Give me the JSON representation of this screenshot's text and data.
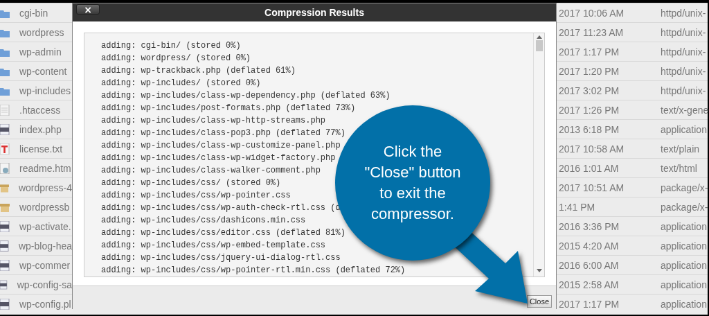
{
  "files": [
    {
      "kind": "folder",
      "name": "cgi-bin",
      "modified": "2017 10:06 AM",
      "type": "httpd/unix-"
    },
    {
      "kind": "folder",
      "name": "wordpress",
      "modified": "2017 11:23 AM",
      "type": "httpd/unix-"
    },
    {
      "kind": "folder",
      "name": "wp-admin",
      "modified": "2017 1:17 PM",
      "type": "httpd/unix-"
    },
    {
      "kind": "folder",
      "name": "wp-content",
      "modified": "2017 1:20 PM",
      "type": "httpd/unix-"
    },
    {
      "kind": "folder",
      "name": "wp-includes",
      "modified": "2017 3:02 PM",
      "type": "httpd/unix-"
    },
    {
      "kind": "file",
      "name": ".htaccess",
      "modified": "2017 1:26 PM",
      "type": "text/x-gene"
    },
    {
      "kind": "php",
      "name": "index.php",
      "modified": "2013 6:18 PM",
      "type": "application"
    },
    {
      "kind": "text",
      "name": "license.txt",
      "modified": "2017 10:58 AM",
      "type": "text/plain"
    },
    {
      "kind": "html",
      "name": "readme.htm",
      "modified": "2016 1:01 AM",
      "type": "text/html"
    },
    {
      "kind": "archive",
      "name": "wordpress-4",
      "modified": "2017 10:51 AM",
      "type": "package/x-"
    },
    {
      "kind": "archive",
      "name": "wordpressb",
      "modified": "1:41 PM",
      "type": "package/x-"
    },
    {
      "kind": "php",
      "name": "wp-activate.",
      "modified": "2016 3:36 PM",
      "type": "application"
    },
    {
      "kind": "php",
      "name": "wp-blog-hea",
      "modified": "2015 4:20 AM",
      "type": "application"
    },
    {
      "kind": "php",
      "name": "wp-commer",
      "modified": "2016 6:00 AM",
      "type": "application"
    },
    {
      "kind": "php",
      "name": "wp-config-sa",
      "modified": "2015 2:58 AM",
      "type": "application"
    },
    {
      "kind": "php",
      "name": "wp-config.pl",
      "modified": "2017 1:17 PM",
      "type": "application"
    }
  ],
  "dialog": {
    "title": "Compression Results",
    "close_symbol": "×",
    "log": [
      "adding: cgi-bin/ (stored 0%)",
      "adding: wordpress/ (stored 0%)",
      "adding: wp-trackback.php (deflated 61%)",
      "adding: wp-includes/ (stored 0%)",
      "adding: wp-includes/class-wp-dependency.php (deflated 63%)",
      "adding: wp-includes/post-formats.php (deflated 73%)",
      "adding: wp-includes/class-wp-http-streams.php",
      "adding: wp-includes/class-pop3.php (deflated 77%)",
      "adding: wp-includes/class-wp-customize-panel.php",
      "adding: wp-includes/class-wp-widget-factory.php",
      "adding: wp-includes/class-walker-comment.php",
      "adding: wp-includes/css/ (stored 0%)",
      "adding: wp-includes/css/wp-pointer.css",
      "adding: wp-includes/css/wp-auth-check-rtl.css (d",
      "adding: wp-includes/css/dashicons.min.css",
      "adding: wp-includes/css/editor.css (deflated 81%)",
      "adding: wp-includes/css/wp-embed-template.css",
      "adding: wp-includes/css/jquery-ui-dialog-rtl.css",
      "adding: wp-includes/css/wp-pointer-rtl.min.css (deflated 72%)"
    ],
    "button": "Close"
  },
  "callout": {
    "text": "Click the \"Close\" button to exit the compressor."
  }
}
